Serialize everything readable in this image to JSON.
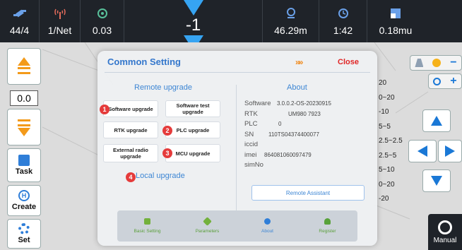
{
  "status_bar": {
    "satellites": "44/4",
    "network": "1/Net",
    "accuracy": "0.03",
    "adjust_value": "-1",
    "distance": "46.29m",
    "time": "1:42",
    "area": "0.18mu"
  },
  "left_toolbar": {
    "value": "0.0",
    "task_label": "Task",
    "create_label": "Create",
    "set_label": "Set"
  },
  "legend": [
    "20",
    "0~20",
    "-10",
    "5~5",
    "2.5~2.5",
    "2.5~5",
    "5~10",
    "0~20",
    "-20"
  ],
  "manual_label": "Manual",
  "dialog": {
    "title": "Common Setting",
    "chevrons": "»»",
    "close_label": "Close",
    "remote_upgrade": {
      "heading": "Remote upgrade",
      "buttons": [
        {
          "label": "Software upgrade",
          "badge": "1"
        },
        {
          "label": "Software test upgrade",
          "badge": ""
        },
        {
          "label": "RTK upgrade",
          "badge": ""
        },
        {
          "label": "PLC upgrade",
          "badge": "2"
        },
        {
          "label": "External radio upgrade",
          "badge": ""
        },
        {
          "label": "MCU upgrade",
          "badge": "3"
        }
      ],
      "local_badge": "4",
      "local_label": "Local upgrade"
    },
    "about": {
      "heading": "About",
      "rows": [
        {
          "key": "Software",
          "value": "3.0.0.2-OS-20230915"
        },
        {
          "key": "RTK",
          "value": "UM980 7923"
        },
        {
          "key": "PLC",
          "value": "0"
        },
        {
          "key": "SN",
          "value": "110TS04374400077"
        },
        {
          "key": "iccid",
          "value": ""
        },
        {
          "key": "imei",
          "value": "864081060097479"
        },
        {
          "key": "simNo",
          "value": ""
        }
      ],
      "remote_assistant": "Remote Assistant"
    },
    "tabs": [
      {
        "label": "Basic Setting",
        "icon": "grid-icon"
      },
      {
        "label": "Parameters",
        "icon": "wrench-icon"
      },
      {
        "label": "About",
        "icon": "info-icon"
      },
      {
        "label": "Register",
        "icon": "user-icon"
      }
    ]
  },
  "colors": {
    "accent_blue": "#3477cc",
    "close_red": "#e02525",
    "badge_red": "#e53b3b",
    "orange": "#f39a1a",
    "status_bar_bg": "#1f2329"
  }
}
